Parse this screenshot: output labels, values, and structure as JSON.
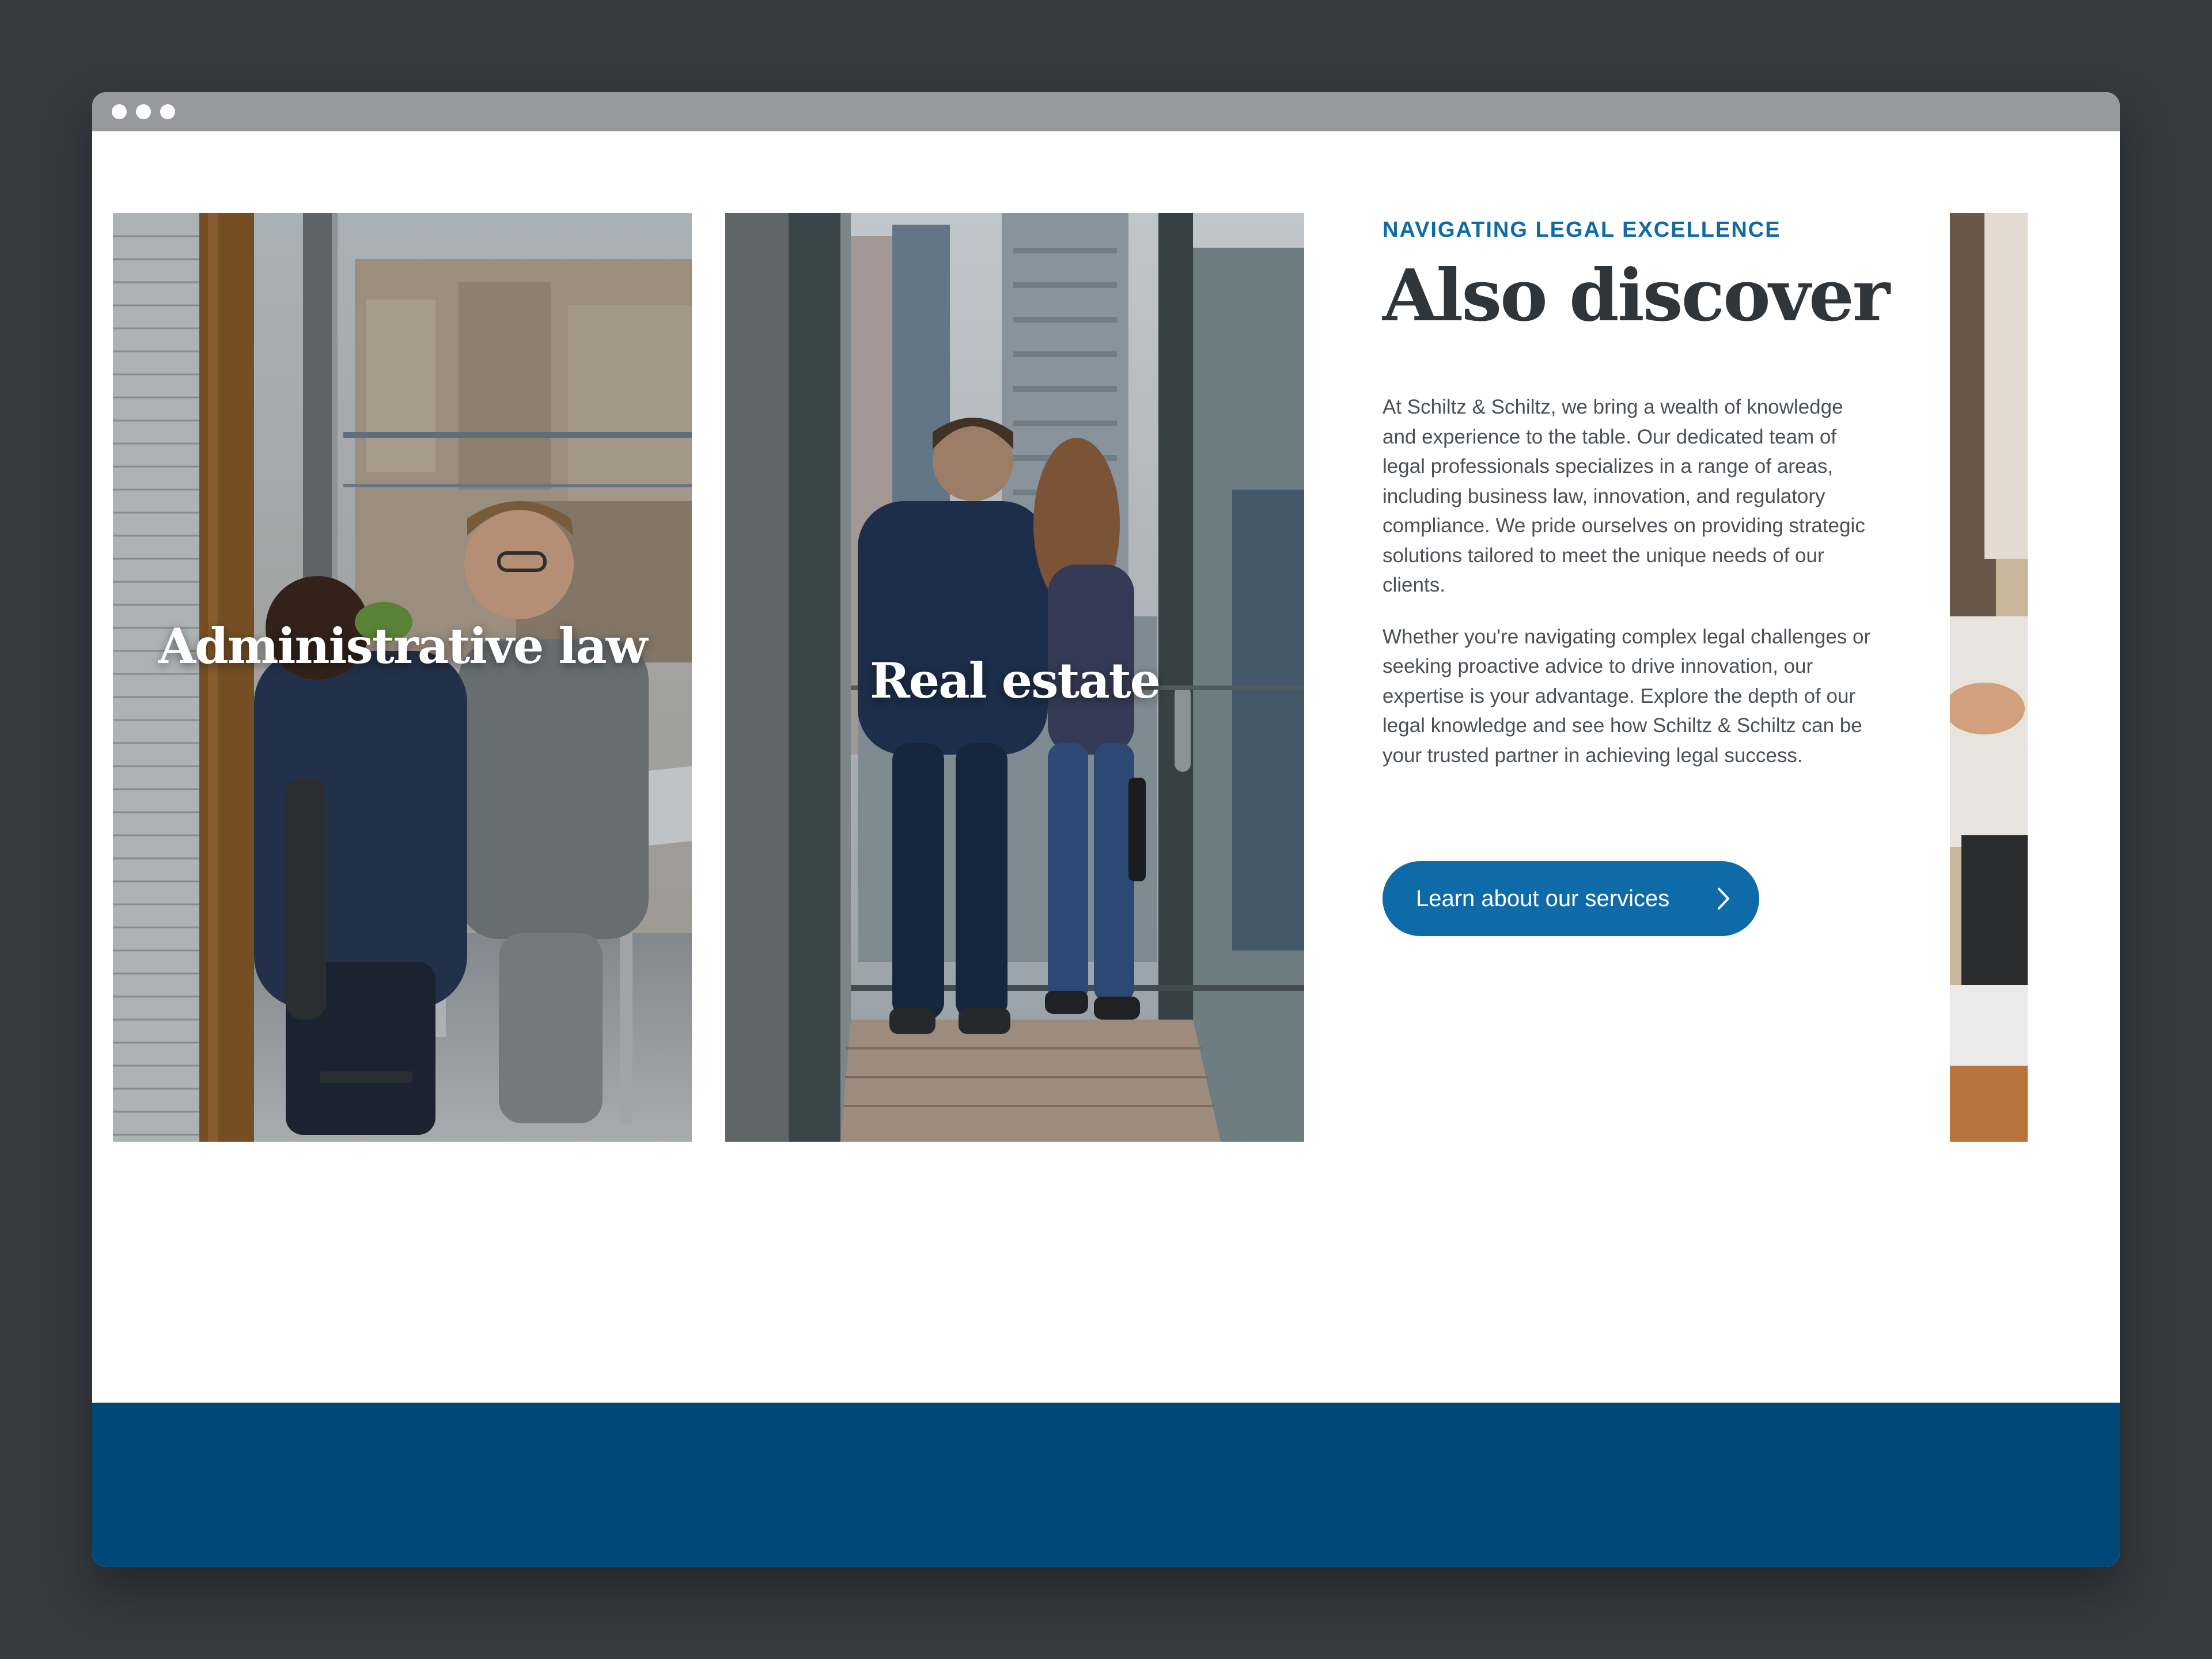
{
  "colors": {
    "accent": "#0f6aa8",
    "heading": "#2f3539",
    "body_text": "#4a5055",
    "footer": "#00477a",
    "titlebar": "#97999d",
    "backdrop": "#363a40"
  },
  "cards": [
    {
      "label": "Administrative law",
      "image": "office-meeting-photo"
    },
    {
      "label": "Real estate",
      "image": "couple-balcony-photo"
    },
    {
      "label": "",
      "image": "desk-laptop-photo"
    }
  ],
  "section": {
    "eyebrow": "NAVIGATING LEGAL EXCELLENCE",
    "title": "Also discover",
    "paragraphs": [
      "At Schiltz & Schiltz, we bring a wealth of knowledge and experience to the table. Our dedicated team of legal professionals specializes in a range of areas, including business law, innovation, and regulatory compliance. We pride ourselves on providing strategic solutions tailored to meet the unique needs of our clients.",
      "Whether you're navigating complex legal challenges or seeking proactive advice to drive innovation, our expertise is your advantage. Explore the depth of our legal knowledge and see how Schiltz & Schiltz can be your trusted partner in achieving legal success."
    ],
    "cta_label": "Learn about our services",
    "cta_icon": "chevron-right-icon"
  }
}
